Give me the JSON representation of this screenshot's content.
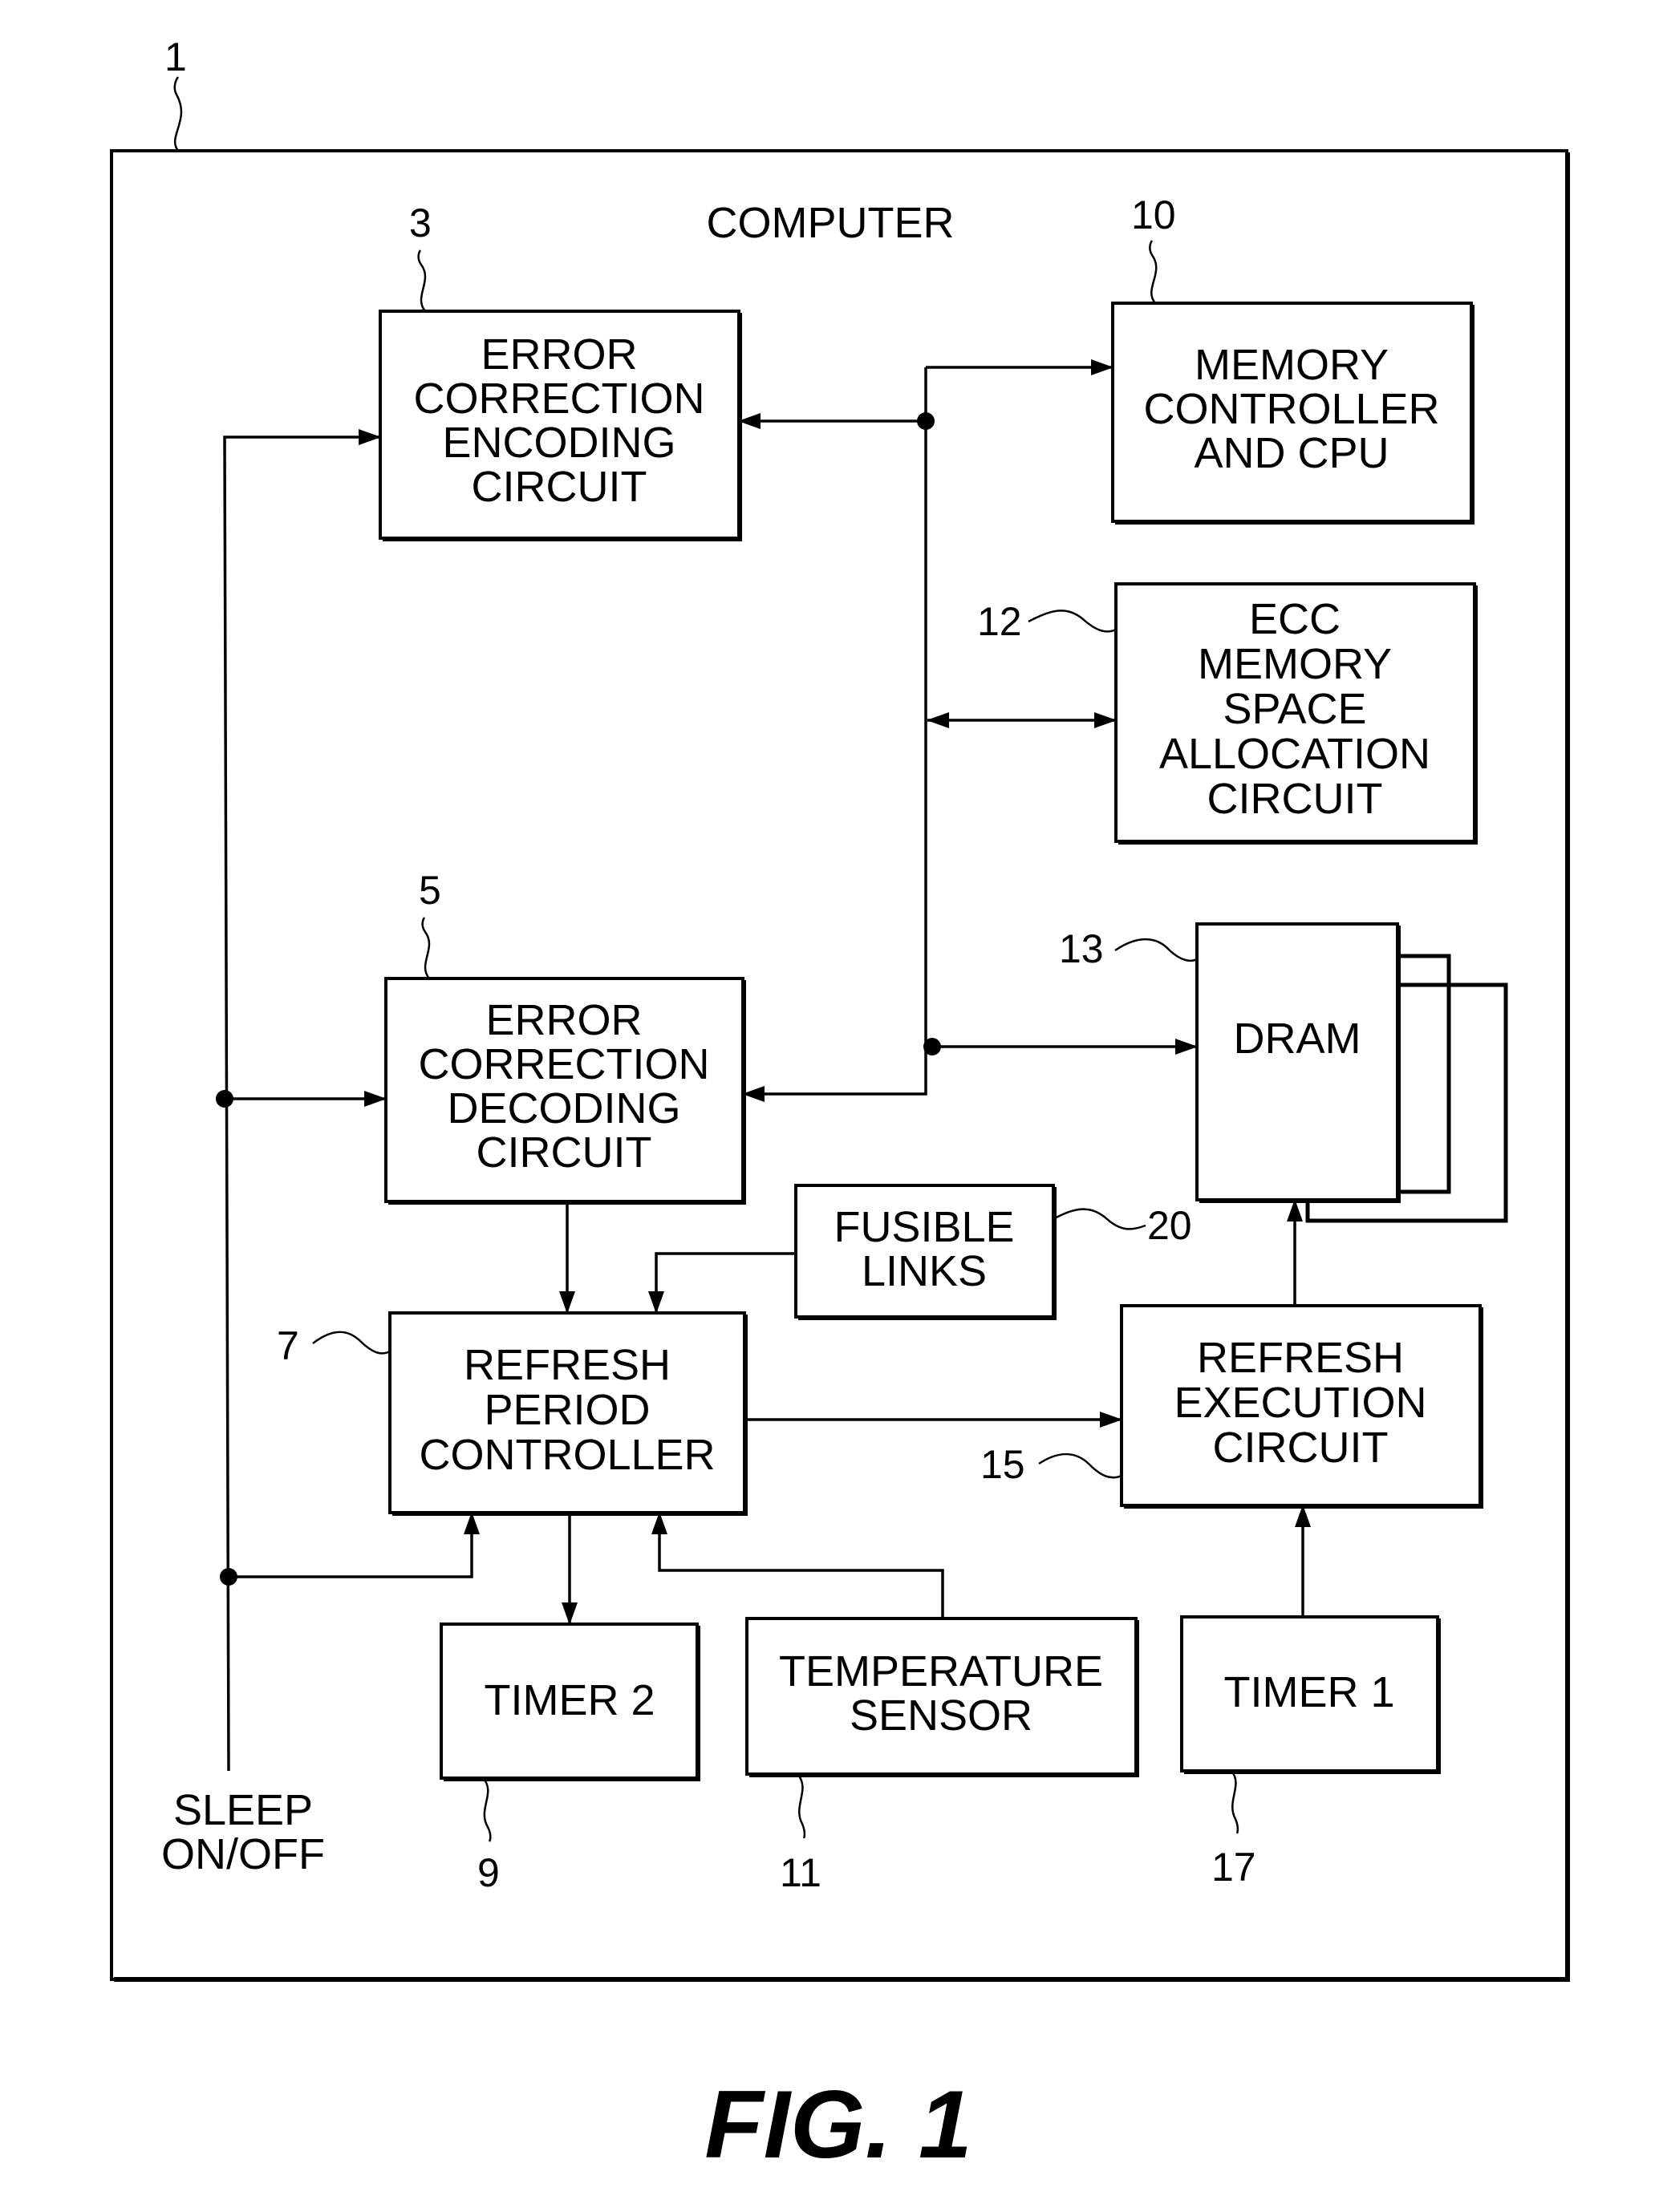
{
  "figure": {
    "caption": "FIG. 1",
    "container": {
      "ref": "1",
      "label": "COMPUTER"
    },
    "blocks": {
      "ecc_encoder": {
        "ref": "3",
        "lines": [
          "ERROR",
          "CORRECTION",
          "ENCODING",
          "CIRCUIT"
        ]
      },
      "memory_controller": {
        "ref": "10",
        "lines": [
          "MEMORY",
          "CONTROLLER",
          "AND CPU"
        ]
      },
      "ecc_allocation": {
        "ref": "12",
        "lines": [
          "ECC",
          "MEMORY",
          "SPACE",
          "ALLOCATION",
          "CIRCUIT"
        ]
      },
      "ecc_decoder": {
        "ref": "5",
        "lines": [
          "ERROR",
          "CORRECTION",
          "DECODING",
          "CIRCUIT"
        ]
      },
      "dram": {
        "ref": "13",
        "lines": [
          "DRAM"
        ]
      },
      "fusible_links": {
        "ref": "20",
        "lines": [
          "FUSIBLE",
          "LINKS"
        ]
      },
      "refresh_period_controller": {
        "ref": "7",
        "lines": [
          "REFRESH",
          "PERIOD",
          "CONTROLLER"
        ]
      },
      "refresh_execution": {
        "ref": "15",
        "lines": [
          "REFRESH",
          "EXECUTION",
          "CIRCUIT"
        ]
      },
      "timer2": {
        "ref": "9",
        "lines": [
          "TIMER 2"
        ]
      },
      "temperature_sensor": {
        "ref": "11",
        "lines": [
          "TEMPERATURE",
          "SENSOR"
        ]
      },
      "timer1": {
        "ref": "17",
        "lines": [
          "TIMER 1"
        ]
      }
    },
    "signals": {
      "sleep": {
        "lines": [
          "SLEEP",
          "ON/OFF"
        ]
      }
    },
    "connections": [
      {
        "from": "bus",
        "to": "ecc_encoder"
      },
      {
        "from": "bus",
        "to": "memory_controller"
      },
      {
        "from": "bus",
        "to": "ecc_allocation",
        "bidirectional": true
      },
      {
        "from": "bus",
        "to": "ecc_decoder"
      },
      {
        "from": "bus",
        "to": "dram"
      },
      {
        "from": "sleep",
        "to": "ecc_encoder"
      },
      {
        "from": "sleep",
        "to": "ecc_decoder"
      },
      {
        "from": "sleep",
        "to": "refresh_period_controller"
      },
      {
        "from": "ecc_decoder",
        "to": "refresh_period_controller"
      },
      {
        "from": "fusible_links",
        "to": "refresh_period_controller"
      },
      {
        "from": "temperature_sensor",
        "to": "refresh_period_controller"
      },
      {
        "from": "refresh_period_controller",
        "to": "timer2"
      },
      {
        "from": "refresh_period_controller",
        "to": "refresh_execution"
      },
      {
        "from": "timer1",
        "to": "refresh_execution"
      },
      {
        "from": "refresh_execution",
        "to": "dram"
      }
    ]
  }
}
